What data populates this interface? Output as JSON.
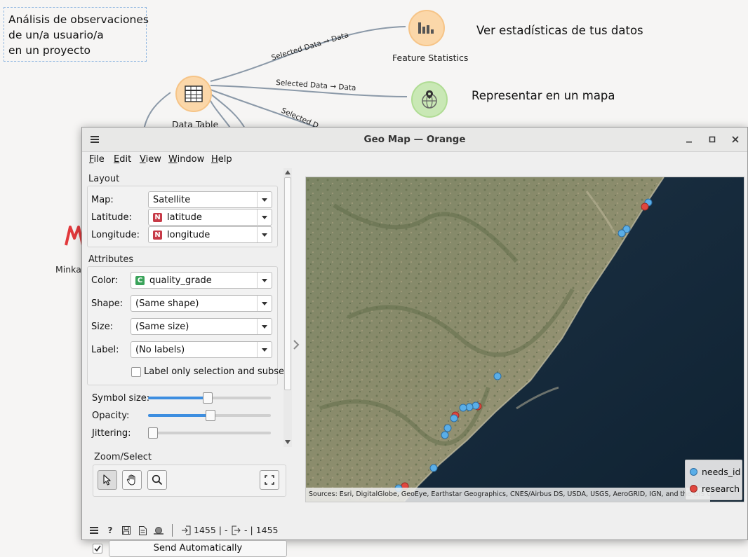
{
  "canvas": {
    "note_lines": [
      "Análisis de observaciones",
      "de un/a usuario/a",
      "en un proyecto"
    ],
    "nodes": {
      "feature_statistics": "Feature Statistics",
      "data_table": "Data Table",
      "minka": "Minka"
    },
    "texts": {
      "stats": "Ver estadísticas de tus datos",
      "map": "Representar en un mapa"
    },
    "links": {
      "to_stats": "Selected Data → Data",
      "to_map": "Selected Data → Data",
      "third": "Selected D"
    }
  },
  "window": {
    "title": "Geo Map — Orange",
    "menu": [
      "File",
      "Edit",
      "View",
      "Window",
      "Help"
    ]
  },
  "layout_section": {
    "title": "Layout",
    "map_label": "Map:",
    "map_value": "Satellite",
    "latitude_label": "Latitude:",
    "latitude_value": "latitude",
    "longitude_label": "Longitude:",
    "longitude_value": "longitude",
    "numeric_badge": "N"
  },
  "attributes_section": {
    "title": "Attributes",
    "color_label": "Color:",
    "color_value": "quality_grade",
    "categorical_badge": "C",
    "shape_label": "Shape:",
    "shape_value": "(Same shape)",
    "size_label": "Size:",
    "size_value": "(Same size)",
    "label_label": "Label:",
    "label_value": "(No labels)",
    "label_only_selection": "Label only selection and subset",
    "label_only_selection_checked": false
  },
  "sliders": {
    "symbol_size_label": "Symbol size:",
    "symbol_size_fraction": 0.48,
    "opacity_label": "Opacity:",
    "opacity_fraction": 0.5,
    "jittering_label": "Jittering:",
    "jittering_fraction": 0.0
  },
  "zoom_select": {
    "title": "Zoom/Select",
    "tools": [
      "pointer-icon",
      "hand-pan-icon",
      "magnifier-icon",
      "fit-screen-icon"
    ]
  },
  "send": {
    "label": "Send Automatically",
    "checked": true
  },
  "status": {
    "input_count": "1455 | -",
    "output_count": "- | 1455"
  },
  "map": {
    "attribution": "Sources: Esri, DigitalGlobe, GeoEye, Earthstar Geographics, CNES/Airbus DS, USDA, USGS, AeroGRID, IGN, and the GIS User Community",
    "legend": [
      {
        "label": "needs_id",
        "color": "#5aaee8"
      },
      {
        "label": "research",
        "color": "#e0473f"
      }
    ]
  },
  "colors": {
    "accent": "#3d8ee0",
    "needs_id": "#5aaee8",
    "research": "#e0473f",
    "widget_orange": "#fbd7a9",
    "widget_green": "#c9e8b5"
  }
}
